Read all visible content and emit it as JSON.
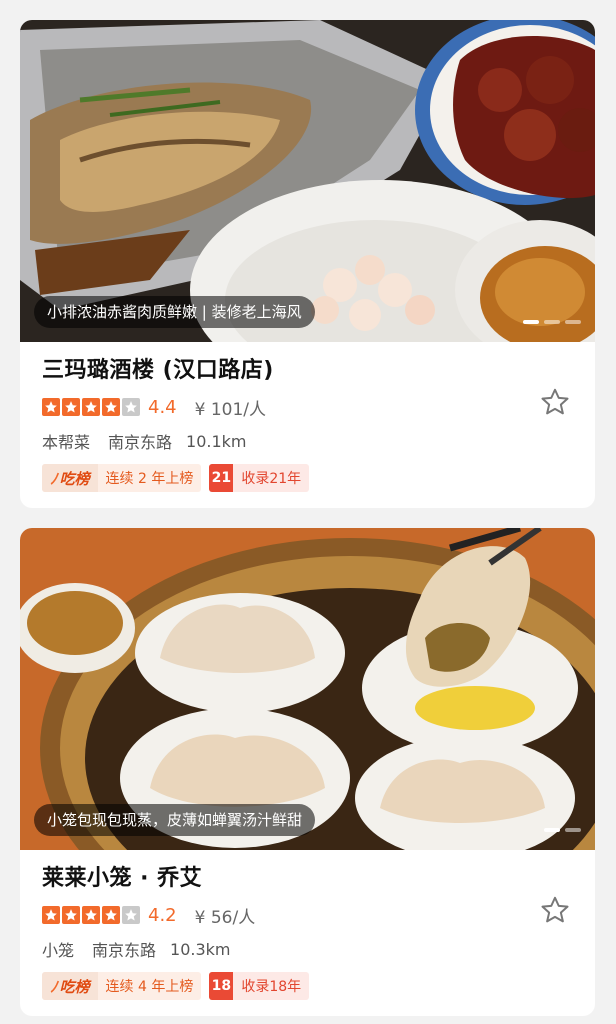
{
  "restaurants": [
    {
      "name": "三玛璐酒楼 (汉口路店)",
      "caption": "小排浓油赤酱肉质鲜嫩 | 装修老上海风",
      "rating": "4.4",
      "stars": 4,
      "price": "¥ 101/人",
      "cuisine": "本帮菜",
      "area": "南京东路",
      "distance": "10.1km",
      "rank_logo": "吃榜",
      "rank_text": "连续 2 年上榜",
      "years_badge": "21",
      "years_text": "收录21年",
      "photo_dots": 3,
      "active_dot": 0,
      "photo_icon": "braised-fish-spareribs-shrimp-photo"
    },
    {
      "name": "莱莱小笼 · 乔艾",
      "caption": "小笼包现包现蒸，皮薄如蝉翼汤汁鲜甜",
      "rating": "4.2",
      "stars": 4,
      "price": "¥ 56/人",
      "cuisine": "小笼",
      "area": "南京东路",
      "distance": "10.3km",
      "rank_logo": "吃榜",
      "rank_text": "连续 4 年上榜",
      "years_badge": "18",
      "years_text": "收录18年",
      "photo_dots": 2,
      "active_dot": 0,
      "photo_icon": "xiaolongbao-steamer-photo"
    }
  ],
  "colors": {
    "accent": "#f26a2b",
    "star_off": "#c9c9c9",
    "rank_bg": "#fdeee6",
    "years_badge": "#ea4a35"
  },
  "icons": {
    "star": "star-icon",
    "favorite": "favorite-star-outline-icon",
    "rank_mark": "flame-mark-icon"
  }
}
